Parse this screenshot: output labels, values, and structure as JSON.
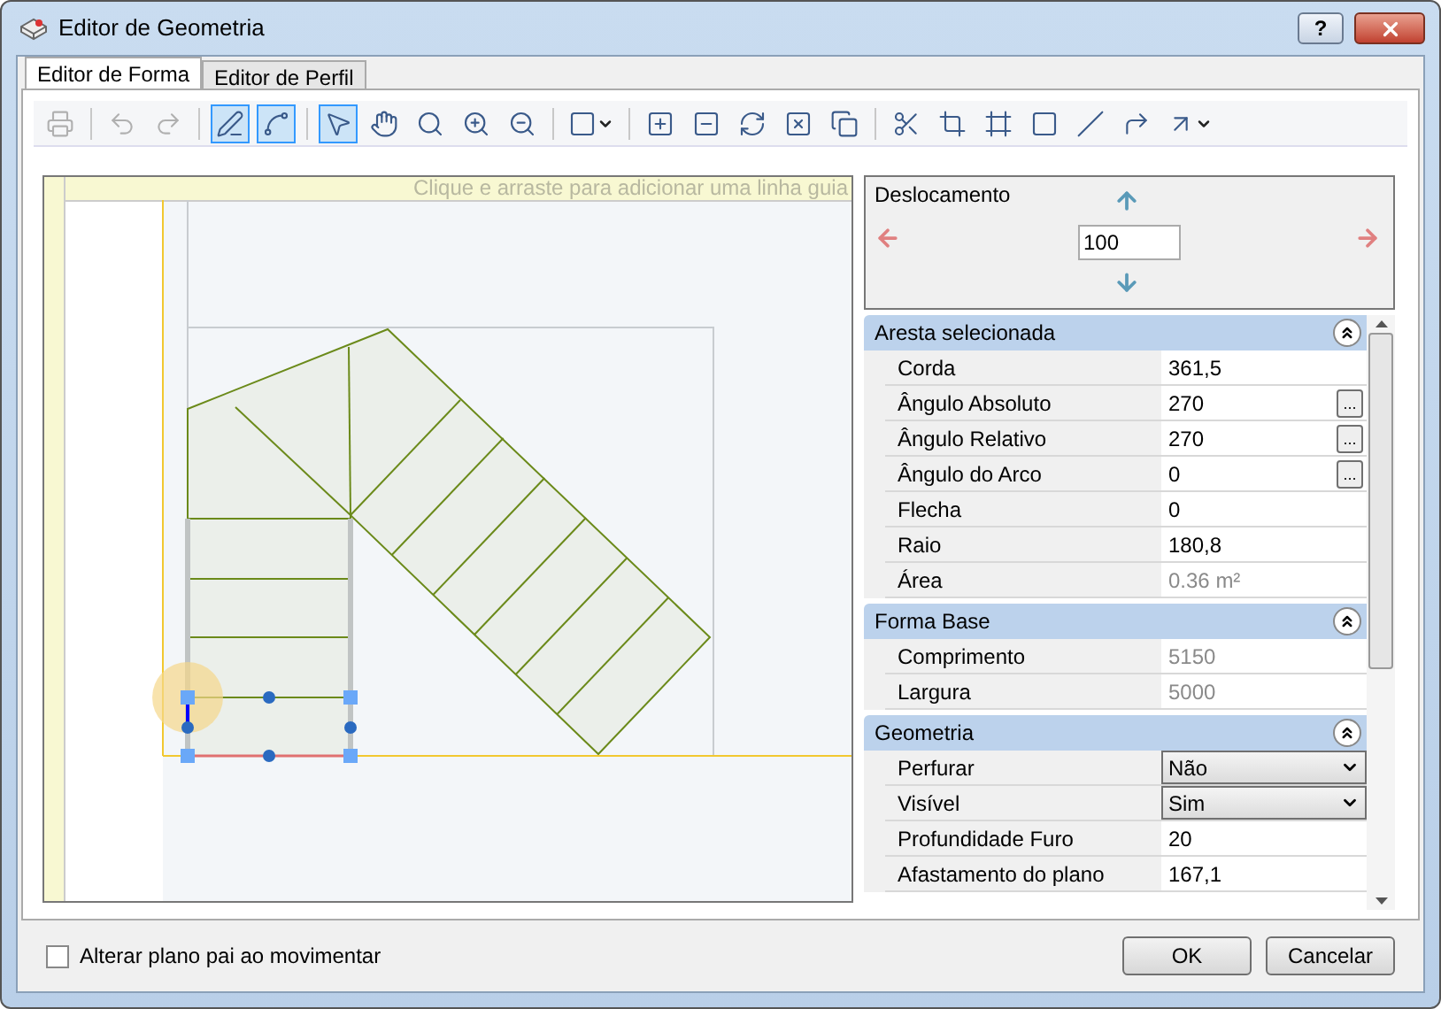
{
  "window": {
    "title": "Editor de Geometria",
    "help_label": "?"
  },
  "tabs": [
    {
      "label": "Editor de Forma",
      "selected": true
    },
    {
      "label": "Editor de Perfil",
      "selected": false
    }
  ],
  "toolbar": {
    "groups": [
      {
        "buttons": [
          {
            "pressed": false,
            "disabled": true
          }
        ]
      },
      {
        "buttons": [
          {
            "pressed": false,
            "disabled": true
          },
          {
            "pressed": false,
            "disabled": true
          }
        ]
      },
      {
        "buttons": [
          {
            "pressed": true,
            "disabled": false
          },
          {
            "pressed": true,
            "disabled": false
          }
        ]
      },
      {
        "buttons": [
          {
            "pressed": true,
            "disabled": false
          },
          {
            "pressed": false,
            "disabled": false
          },
          {
            "pressed": false,
            "disabled": false
          },
          {
            "pressed": false,
            "disabled": false
          },
          {
            "pressed": false,
            "disabled": false
          }
        ]
      },
      {
        "buttons": [
          {
            "pressed": false,
            "disabled": false,
            "dropdown": true
          }
        ]
      },
      {
        "buttons": [
          {
            "pressed": false,
            "disabled": false
          },
          {
            "pressed": false,
            "disabled": false
          },
          {
            "pressed": false,
            "disabled": false
          },
          {
            "pressed": false,
            "disabled": false
          },
          {
            "pressed": false,
            "disabled": false
          }
        ]
      },
      {
        "buttons": [
          {
            "pressed": false,
            "disabled": false
          },
          {
            "pressed": false,
            "disabled": false
          },
          {
            "pressed": false,
            "disabled": false
          },
          {
            "pressed": false,
            "disabled": false
          },
          {
            "pressed": false,
            "disabled": false
          },
          {
            "pressed": false,
            "disabled": false
          },
          {
            "pressed": false,
            "disabled": false,
            "dropdown": true
          }
        ]
      }
    ]
  },
  "canvas": {
    "guide_hint": "Clique e arraste para adicionar uma linha guia"
  },
  "offset": {
    "label": "Deslocamento",
    "value": "100"
  },
  "sections": [
    {
      "title": "Aresta selecionada",
      "expanded": true,
      "rows": [
        {
          "kind": "text",
          "label": "Corda",
          "value": "361,5",
          "readonly": false
        },
        {
          "kind": "ellipsis",
          "label": "Ângulo Absoluto",
          "value": "270",
          "readonly": false,
          "button_label": "..."
        },
        {
          "kind": "ellipsis",
          "label": "Ângulo Relativo",
          "value": "270",
          "readonly": false,
          "button_label": "..."
        },
        {
          "kind": "ellipsis",
          "label": "Ângulo do Arco",
          "value": "0",
          "readonly": false,
          "button_label": "..."
        },
        {
          "kind": "text",
          "label": "Flecha",
          "value": "0",
          "readonly": false
        },
        {
          "kind": "text",
          "label": "Raio",
          "value": "180,8",
          "readonly": false
        },
        {
          "kind": "text",
          "label": "Área",
          "value": "0.36 m²",
          "readonly": true
        }
      ]
    },
    {
      "title": "Forma Base",
      "expanded": true,
      "rows": [
        {
          "kind": "text",
          "label": "Comprimento",
          "value": "5150",
          "readonly": true
        },
        {
          "kind": "text",
          "label": "Largura",
          "value": "5000",
          "readonly": true
        }
      ]
    },
    {
      "title": "Geometria",
      "expanded": true,
      "rows": [
        {
          "kind": "dropdown",
          "label": "Perfurar",
          "value": "Não",
          "readonly": false
        },
        {
          "kind": "dropdown",
          "label": "Visível",
          "value": "Sim",
          "readonly": false
        },
        {
          "kind": "text",
          "label": "Profundidade Furo",
          "value": "20",
          "readonly": false
        },
        {
          "kind": "text",
          "label": "Afastamento do plano",
          "value": "167,1",
          "readonly": false
        }
      ]
    }
  ],
  "footer": {
    "checkbox": {
      "label": "Alterar plano pai ao movimentar",
      "checked": false
    },
    "buttons": [
      "OK",
      "Cancelar"
    ]
  }
}
